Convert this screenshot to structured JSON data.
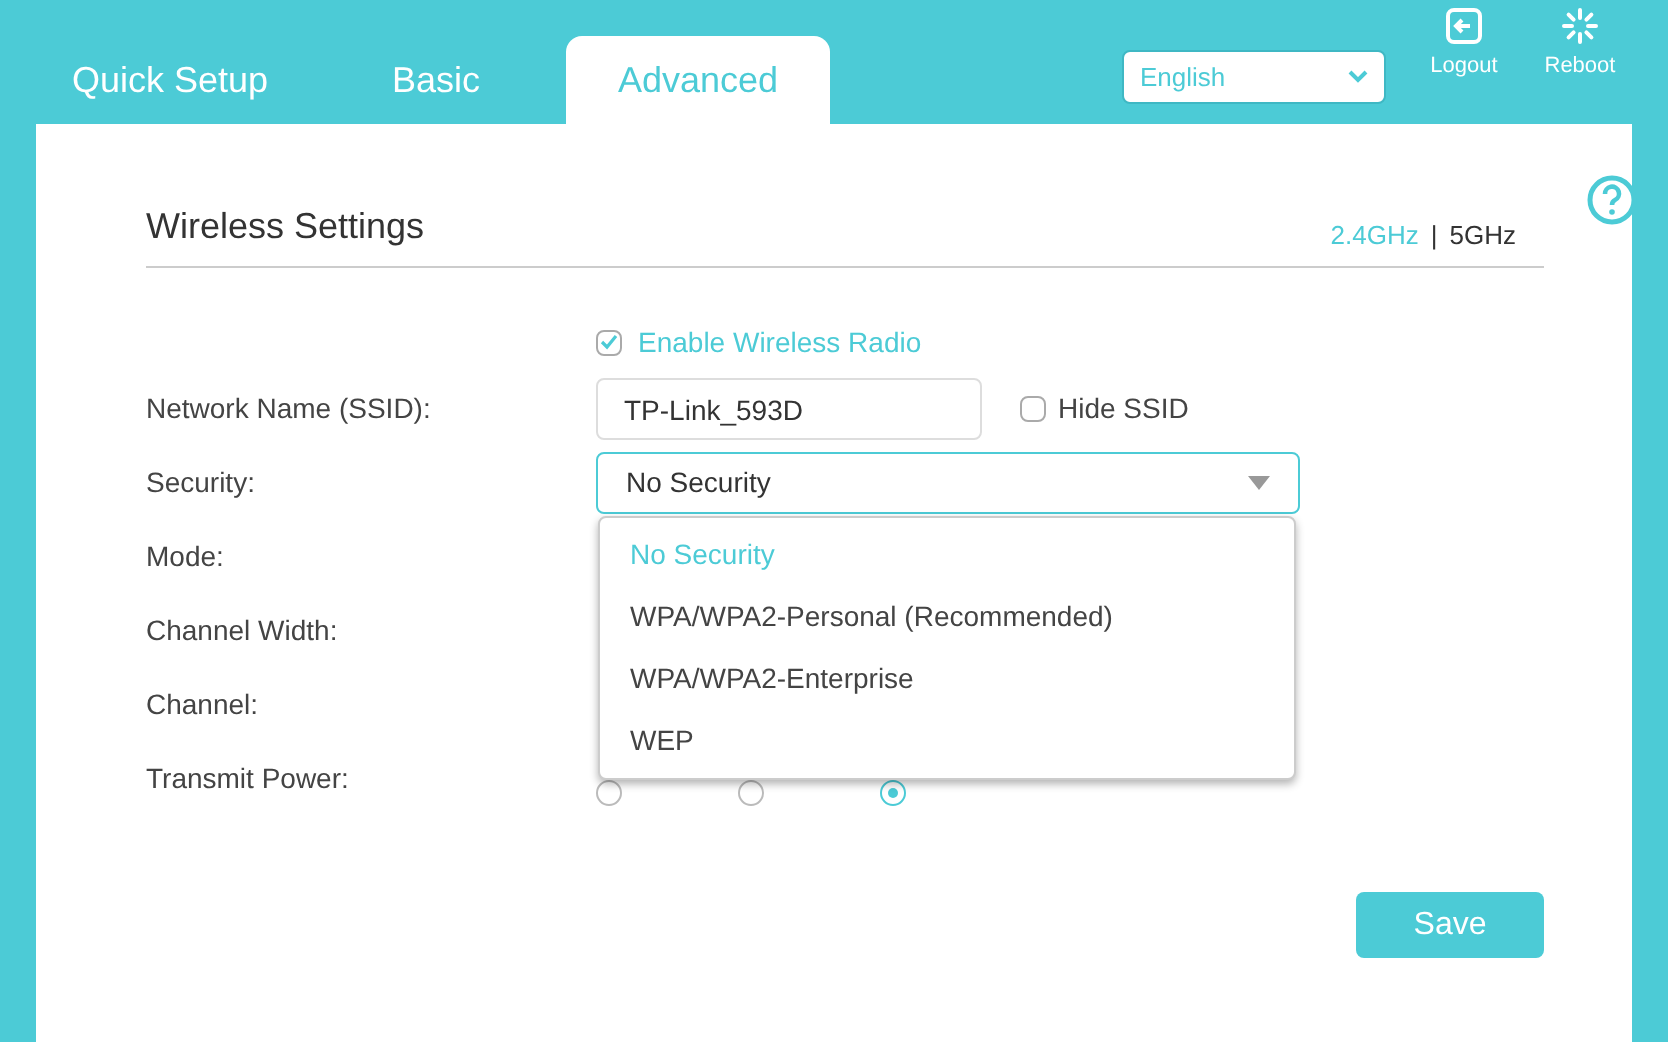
{
  "tabs": [
    {
      "label": "Quick Setup",
      "selected": false
    },
    {
      "label": "Basic",
      "selected": false
    },
    {
      "label": "Advanced",
      "selected": true
    }
  ],
  "language": {
    "value": "English"
  },
  "actions": [
    {
      "kind": "logout",
      "label": "Logout"
    },
    {
      "kind": "reboot",
      "label": "Reboot"
    }
  ],
  "section": {
    "title": "Wireless Settings",
    "bands": [
      {
        "label": "2.4GHz",
        "selected": true
      },
      {
        "label": "5GHz",
        "selected": false
      }
    ],
    "separator": "|"
  },
  "enable_radio": {
    "label": "Enable Wireless Radio",
    "checked": true
  },
  "fields": [
    {
      "label": "Network Name (SSID):",
      "kind": "ssid",
      "value": "TP-Link_593D",
      "hide_label": "Hide SSID",
      "hide_checked": false
    },
    {
      "label": "Security:",
      "kind": "select",
      "value": "No Security"
    },
    {
      "label": "Mode:",
      "kind": "covered"
    },
    {
      "label": "Channel Width:",
      "kind": "covered"
    },
    {
      "label": "Channel:",
      "kind": "covered"
    },
    {
      "label": "Transmit Power:",
      "kind": "radios",
      "options": [
        {
          "selected": false
        },
        {
          "selected": false
        },
        {
          "selected": true
        }
      ]
    }
  ],
  "dropdown": [
    {
      "label": "No Security",
      "selected": true
    },
    {
      "label": "WPA/WPA2-Personal (Recommended)",
      "selected": false
    },
    {
      "label": "WPA/WPA2-Enterprise",
      "selected": false
    },
    {
      "label": "WEP",
      "selected": false
    }
  ],
  "save": {
    "label": "Save"
  }
}
